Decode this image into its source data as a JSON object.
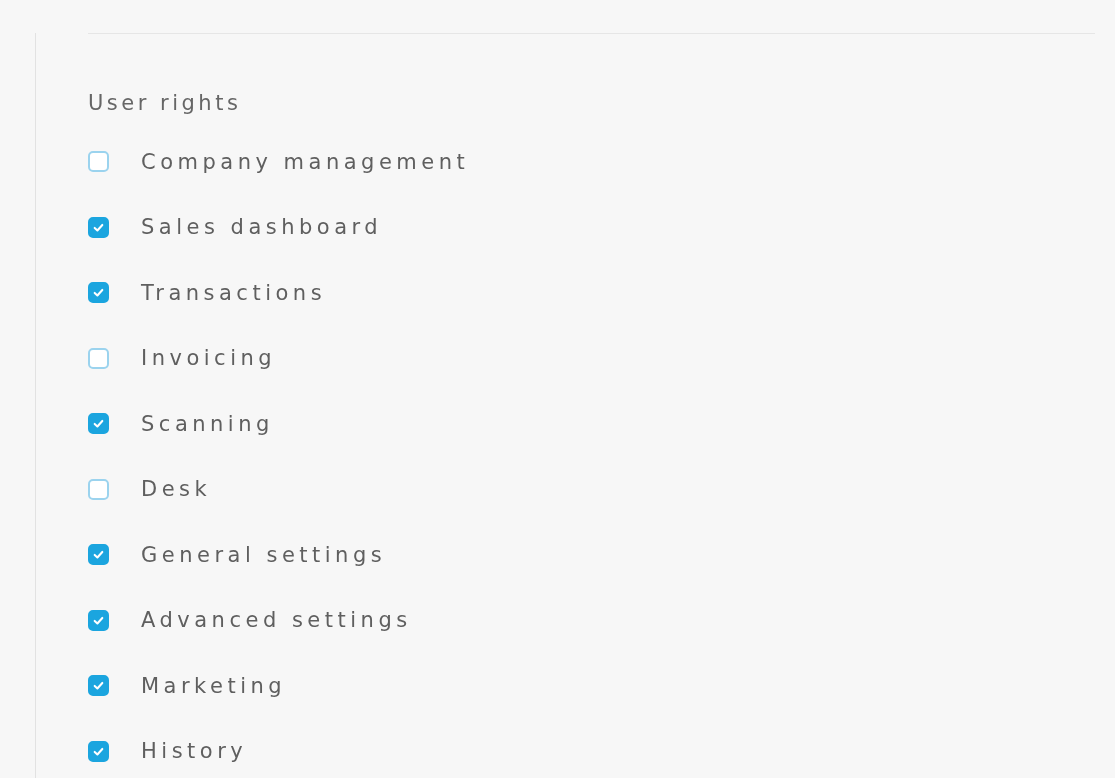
{
  "section": {
    "title": "User rights",
    "rights": [
      {
        "label": "Company management",
        "checked": false
      },
      {
        "label": "Sales dashboard",
        "checked": true
      },
      {
        "label": "Transactions",
        "checked": true
      },
      {
        "label": "Invoicing",
        "checked": false
      },
      {
        "label": "Scanning",
        "checked": true
      },
      {
        "label": "Desk",
        "checked": false
      },
      {
        "label": "General settings",
        "checked": true
      },
      {
        "label": "Advanced settings",
        "checked": true
      },
      {
        "label": "Marketing",
        "checked": true
      },
      {
        "label": "History",
        "checked": true
      }
    ]
  }
}
